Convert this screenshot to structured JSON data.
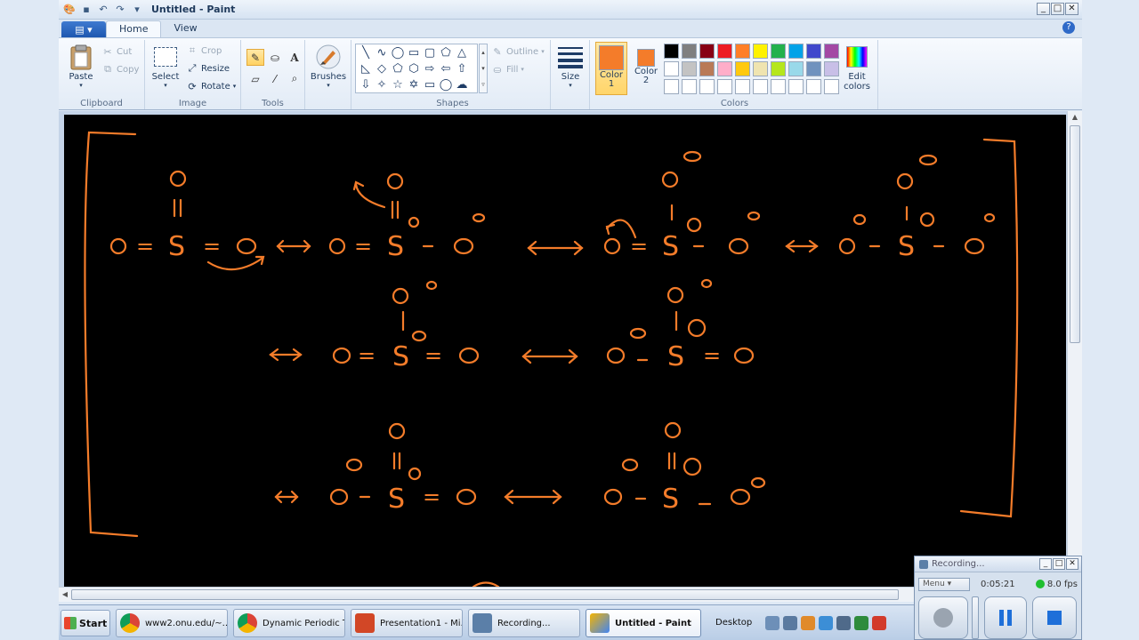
{
  "window": {
    "title": "Untitled - Paint"
  },
  "tabs": [
    {
      "label": "Home"
    },
    {
      "label": "View"
    }
  ],
  "clipboard": {
    "paste": "Paste",
    "cut": "Cut",
    "copy": "Copy",
    "group": "Clipboard"
  },
  "image": {
    "select": "Select",
    "crop": "Crop",
    "resize": "Resize",
    "rotate": "Rotate",
    "group": "Image"
  },
  "tools": {
    "group": "Tools"
  },
  "brushes": {
    "label": "Brushes"
  },
  "shapes": {
    "outline": "Outline",
    "fill": "Fill",
    "group": "Shapes"
  },
  "size": {
    "label": "Size"
  },
  "colors": {
    "color1": {
      "label": "Color",
      "num": "1",
      "value": "#f47c2a"
    },
    "color2": {
      "label": "Color",
      "num": "2",
      "value": "#f47c2a"
    },
    "edit": "Edit colors",
    "group": "Colors",
    "palette": [
      "#000000",
      "#7f7f7f",
      "#880015",
      "#ed1c24",
      "#ff7f27",
      "#fff200",
      "#22b14c",
      "#00a2e8",
      "#3f48cc",
      "#a349a4",
      "#ffffff",
      "#c3c3c3",
      "#b97a57",
      "#ffaec9",
      "#ffc90e",
      "#efe4b0",
      "#b5e61d",
      "#99d9ea",
      "#7092be",
      "#c8bfe7",
      "#ffffff",
      "#ffffff",
      "#ffffff",
      "#ffffff",
      "#ffffff",
      "#ffffff",
      "#ffffff",
      "#ffffff",
      "#ffffff",
      "#ffffff"
    ]
  },
  "canvas": {
    "background": "#000000",
    "ink": "#f47c2a",
    "drawing": "Hand-drawn resonance structures of sulfur trioxide"
  },
  "taskbar": {
    "start": "Start",
    "items": [
      {
        "label": "www2.onu.edu/~..."
      },
      {
        "label": "Dynamic Periodic T..."
      },
      {
        "label": "Presentation1 - Mi..."
      },
      {
        "label": "Recording..."
      },
      {
        "label": "Untitled - Paint"
      }
    ],
    "desktop": "Desktop"
  },
  "recorder": {
    "title": "Recording...",
    "menu": "Menu",
    "time": "0:05:21",
    "fps": "8.0 fps"
  }
}
